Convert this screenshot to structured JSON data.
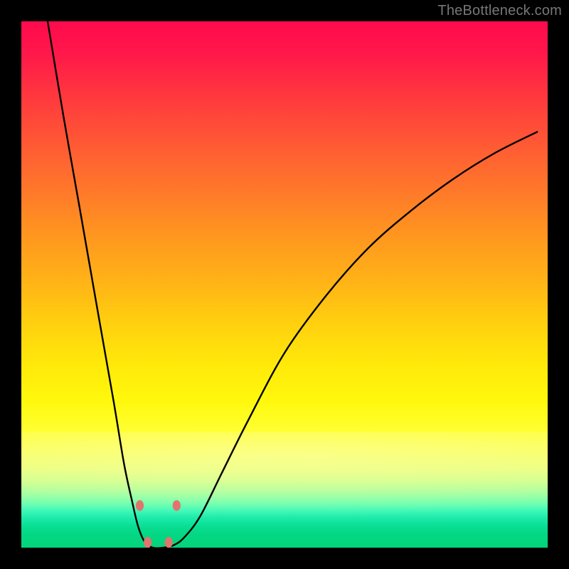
{
  "watermark": {
    "text": "TheBottleneck.com"
  },
  "chart_data": {
    "type": "line",
    "title": "",
    "xlabel": "",
    "ylabel": "",
    "xlim": [
      0,
      100
    ],
    "ylim": [
      0,
      100
    ],
    "grid": false,
    "legend": false,
    "background": {
      "type": "vertical-gradient",
      "stops": [
        {
          "pct": 0,
          "color": "#ff0a4d"
        },
        {
          "pct": 15,
          "color": "#ff3b3d"
        },
        {
          "pct": 40,
          "color": "#ff9420"
        },
        {
          "pct": 65,
          "color": "#ffe80a"
        },
        {
          "pct": 85,
          "color": "#c8ff8f"
        },
        {
          "pct": 100,
          "color": "#03d47b"
        }
      ]
    },
    "series": [
      {
        "name": "bottleneck-curve",
        "color": "#000000",
        "x": [
          5,
          8,
          11,
          14.5,
          17.5,
          19.5,
          21,
          22.2,
          23.5,
          25,
          27,
          29,
          31,
          34,
          38,
          43,
          50,
          58,
          66,
          74,
          82,
          90,
          98
        ],
        "y": [
          100,
          82,
          65,
          45,
          28,
          16,
          9,
          4,
          1,
          0,
          0,
          0.5,
          2,
          6,
          14,
          24,
          37,
          48,
          57,
          64,
          70,
          75,
          79
        ]
      }
    ],
    "markers": [
      {
        "x": 22.5,
        "y": 8,
        "color": "#e2746d",
        "r": 4
      },
      {
        "x": 29.5,
        "y": 8,
        "color": "#e2746d",
        "r": 4
      },
      {
        "x": 24.0,
        "y": 1,
        "color": "#e2746d",
        "r": 4
      },
      {
        "x": 28.0,
        "y": 1,
        "color": "#e2746d",
        "r": 4
      }
    ]
  }
}
